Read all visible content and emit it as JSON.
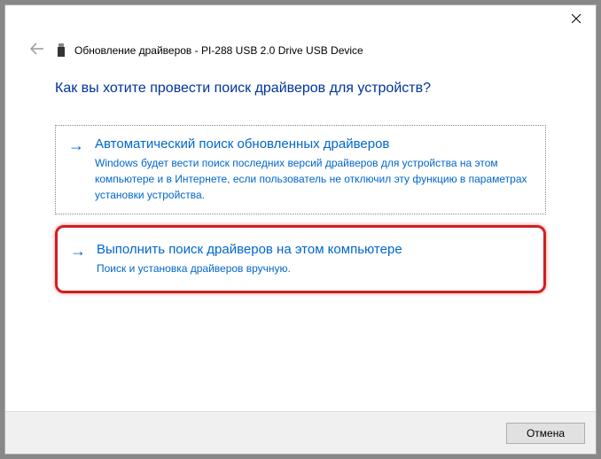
{
  "header": {
    "title": "Обновление драйверов - PI-288 USB 2.0 Drive USB Device"
  },
  "main": {
    "heading": "Как вы хотите провести поиск драйверов для устройств?",
    "options": [
      {
        "title": "Автоматический поиск обновленных драйверов",
        "desc": "Windows будет вести поиск последних версий драйверов для устройства на этом компьютере и в Интернете, если пользователь не отключил эту функцию в параметрах установки устройства."
      },
      {
        "title": "Выполнить поиск драйверов на этом компьютере",
        "desc": "Поиск и установка драйверов вручную."
      }
    ]
  },
  "footer": {
    "cancel": "Отмена"
  }
}
